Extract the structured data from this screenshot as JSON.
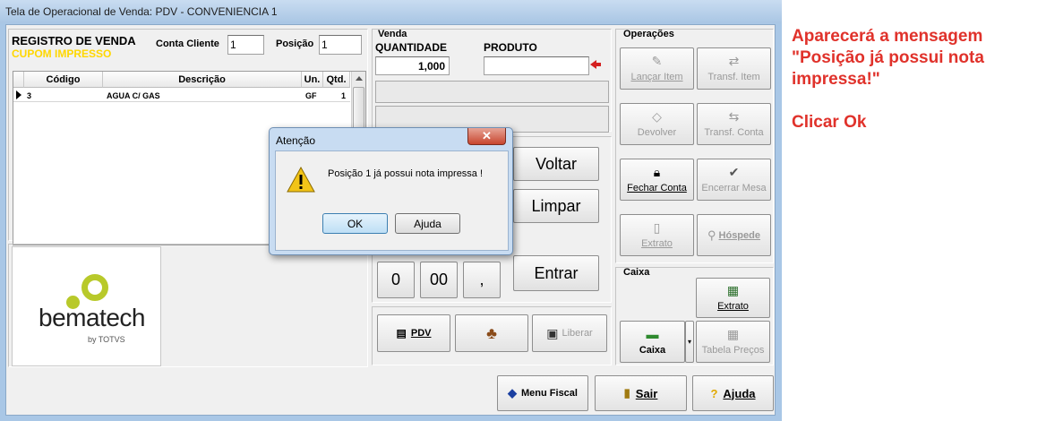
{
  "window": {
    "title": "Tela de Operacional de Venda: PDV - CONVENIENCIA 1"
  },
  "registro": {
    "title": "REGISTRO DE VENDA",
    "status": "CUPOM IMPRESSO",
    "conta_label": "Conta Cliente",
    "conta_value": "1",
    "posicao_label": "Posição",
    "posicao_value": "1"
  },
  "grid": {
    "columns": [
      "Código",
      "Descrição",
      "Un.",
      "Qtd."
    ],
    "rows": [
      {
        "codigo": "3",
        "descricao": "AGUA C/ GAS",
        "un": "GF",
        "qtd": "1"
      }
    ]
  },
  "logo": {
    "name": "bematech",
    "sub": "by TOTVS"
  },
  "venda": {
    "group": "Venda",
    "quantidade_label": "QUANTIDADE",
    "quantidade_value": "1,000",
    "produto_label": "PRODUTO",
    "produto_value": ""
  },
  "keypad": {
    "voltar": "Voltar",
    "limpar": "Limpar",
    "entrar": "Entrar",
    "k0": "0",
    "k00": "00",
    "kcomma": ","
  },
  "bottom_buttons": {
    "pdv": "PDV",
    "liberar": "Liberar"
  },
  "operacoes": {
    "group": "Operações",
    "lancar": "Lançar Item",
    "transf_item": "Transf. Item",
    "devolver": "Devolver",
    "transf_conta": "Transf. Conta",
    "fechar_conta": "Fechar Conta",
    "encerrar_mesa": "Encerrar Mesa",
    "extrato": "Extrato",
    "hospede": "Hóspede"
  },
  "caixa": {
    "group": "Caixa",
    "extrato": "Extrato",
    "caixa": "Caixa",
    "tabela": "Tabela Preços"
  },
  "footer": {
    "menu_fiscal": "Menu Fiscal",
    "sair": "Sair",
    "ajuda": "Ajuda"
  },
  "dialog": {
    "title": "Atenção",
    "message": "Posição 1 já possui nota impressa !",
    "ok": "OK",
    "ajuda": "Ajuda"
  },
  "annotation": {
    "line1": "Aparecerá a mensagem",
    "line2": "\"Posição já possui nota",
    "line3": "impressa!\"",
    "line4": "Clicar Ok"
  },
  "colors": {
    "status": "#ffd700",
    "annotation": "#e0322b",
    "arrow": "#d42020"
  }
}
